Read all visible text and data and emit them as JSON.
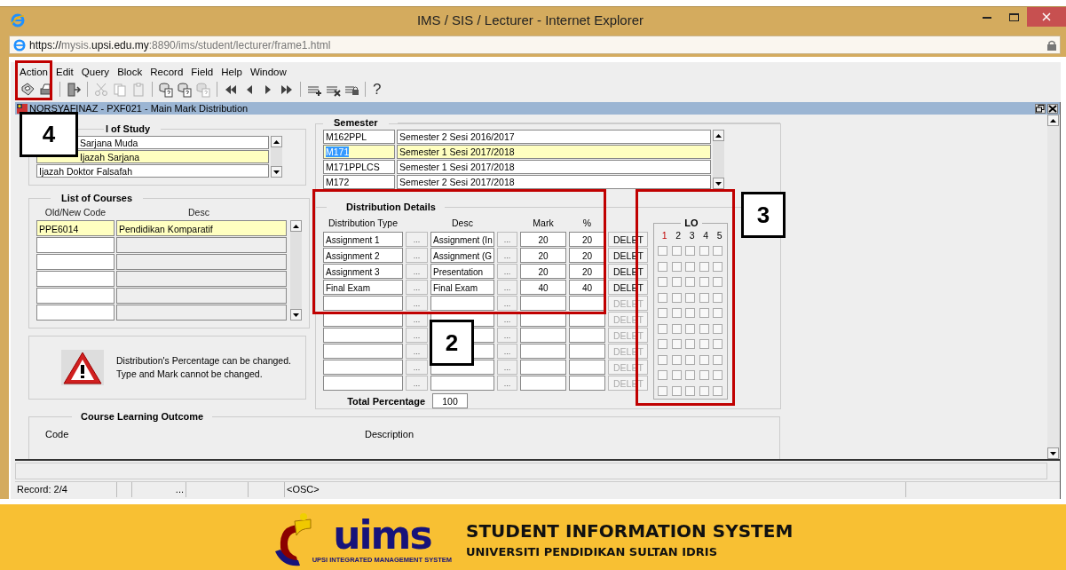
{
  "window": {
    "title": "IMS / SIS / Lecturer - Internet Explorer"
  },
  "address": {
    "scheme": "https://",
    "host_pre": "mysis.",
    "host": "upsi.edu.my",
    "rest": ":8890/ims/student/lecturer/frame1.html"
  },
  "menu": [
    "Action",
    "Edit",
    "Query",
    "Block",
    "Record",
    "Field",
    "Help",
    "Window"
  ],
  "toolbar": [
    {
      "kind": "save",
      "disabled": false
    },
    {
      "kind": "print",
      "disabled": false
    },
    {
      "kind": "sep"
    },
    {
      "kind": "exit",
      "disabled": false
    },
    {
      "kind": "sep"
    },
    {
      "kind": "cut",
      "disabled": true
    },
    {
      "kind": "copy",
      "disabled": true
    },
    {
      "kind": "paste",
      "disabled": true
    },
    {
      "kind": "sep"
    },
    {
      "kind": "query",
      "disabled": false
    },
    {
      "kind": "execute",
      "disabled": false
    },
    {
      "kind": "cancel",
      "disabled": true
    },
    {
      "kind": "sep"
    },
    {
      "kind": "first",
      "disabled": false
    },
    {
      "kind": "prev",
      "disabled": false
    },
    {
      "kind": "next",
      "disabled": false
    },
    {
      "kind": "last",
      "disabled": false
    },
    {
      "kind": "sep"
    },
    {
      "kind": "insert",
      "disabled": false
    },
    {
      "kind": "delete",
      "disabled": false
    },
    {
      "kind": "lock",
      "disabled": false
    },
    {
      "kind": "sep"
    },
    {
      "kind": "help",
      "text": "?"
    }
  ],
  "form": {
    "title": "NORSYAFINAZ - PXF021 - Main Mark Distribution"
  },
  "level_of_study": {
    "title": "l of Study",
    "items": [
      {
        "label": "Sarjana Muda",
        "selected": false
      },
      {
        "label": "Ijazah Sarjana",
        "selected": true
      },
      {
        "label": "Ijazah Doktor Falsafah",
        "selected": false
      }
    ]
  },
  "courses": {
    "title": "List of Courses",
    "columns": [
      "Old/New Code",
      "Desc"
    ],
    "rows": [
      {
        "code": "PPE6014",
        "desc": "Pendidikan Komparatif",
        "selected": true
      },
      {
        "selected": false
      },
      {
        "selected": false
      },
      {
        "selected": false
      },
      {
        "selected": false
      },
      {
        "selected": false
      }
    ]
  },
  "notice": {
    "lines": [
      "Distribution's Percentage can be changed.",
      "Type and Mark cannot be changed."
    ]
  },
  "semester": {
    "title": "Semester",
    "rows": [
      {
        "code": "M162PPL",
        "desc": "Semester 2 Sesi 2016/2017",
        "selected": false,
        "code_highlighted": false
      },
      {
        "code": "M171",
        "desc": "Semester 1 Sesi 2017/2018",
        "selected": true,
        "code_highlighted": true
      },
      {
        "code": "M171PPLCS",
        "desc": "Semester 1 Sesi 2017/2018",
        "selected": false,
        "code_highlighted": false
      },
      {
        "code": "M172",
        "desc": "Semester 2 Sesi 2017/2018",
        "selected": false,
        "code_highlighted": false
      }
    ]
  },
  "distribution": {
    "title": "Distribution Details",
    "columns": [
      "Distribution Type",
      "Desc",
      "Mark",
      "%"
    ],
    "rows": [
      {
        "type": "Assignment 1",
        "type_button": "...",
        "desc": "Assignment (In",
        "desc_button": "...",
        "mark": "20",
        "percent": "20",
        "delete": "DELET",
        "disabled": false
      },
      {
        "type": "Assignment 2",
        "type_button": "...",
        "desc": "Assignment (G",
        "desc_button": "...",
        "mark": "20",
        "percent": "20",
        "delete": "DELET",
        "disabled": false
      },
      {
        "type": "Assignment 3",
        "type_button": "...",
        "desc": "Presentation",
        "desc_button": "...",
        "mark": "20",
        "percent": "20",
        "delete": "DELET",
        "disabled": false
      },
      {
        "type": "Final Exam",
        "type_button": "...",
        "desc": "Final Exam",
        "desc_button": "...",
        "mark": "40",
        "percent": "40",
        "delete": "DELET",
        "disabled": false
      },
      {
        "type_button": "...",
        "desc_button": "...",
        "delete": "DELET",
        "disabled": true
      },
      {
        "type_button": "...",
        "desc_button": "...",
        "delete": "DELET",
        "disabled": true
      },
      {
        "type_button": "...",
        "desc_button": "...",
        "delete": "DELET",
        "disabled": true
      },
      {
        "type_button": "...",
        "desc_button": "...",
        "delete": "DELET",
        "disabled": true
      },
      {
        "type_button": "...",
        "desc_button": "...",
        "delete": "DELET",
        "disabled": true
      },
      {
        "type_button": "...",
        "desc_button": "...",
        "delete": "DELET",
        "disabled": true
      }
    ],
    "total_label": "Total Percentage",
    "total": "100"
  },
  "lo": {
    "title": "LO",
    "columns": [
      {
        "label": "1",
        "selected": true
      },
      {
        "label": "2",
        "selected": false
      },
      {
        "label": "3",
        "selected": false
      },
      {
        "label": "4",
        "selected": false
      },
      {
        "label": "5",
        "selected": false
      }
    ],
    "rows": [
      {
        "checked": [
          false,
          false,
          false,
          false,
          false
        ]
      },
      {
        "checked": [
          false,
          false,
          false,
          false,
          false
        ]
      },
      {
        "checked": [
          false,
          false,
          false,
          false,
          false
        ]
      },
      {
        "checked": [
          false,
          false,
          false,
          false,
          false
        ]
      },
      {
        "checked": [
          false,
          false,
          false,
          false,
          false
        ]
      },
      {
        "checked": [
          false,
          false,
          false,
          false,
          false
        ]
      },
      {
        "checked": [
          false,
          false,
          false,
          false,
          false
        ]
      },
      {
        "checked": [
          false,
          false,
          false,
          false,
          false
        ]
      },
      {
        "checked": [
          false,
          false,
          false,
          false,
          false
        ]
      },
      {
        "checked": [
          false,
          false,
          false,
          false,
          false
        ]
      }
    ]
  },
  "clo": {
    "title": "Course Learning Outcome",
    "columns": [
      "Code",
      "Description"
    ]
  },
  "status_bar": {
    "record": "Record: 2/4",
    "dots": "...",
    "mode": "<OSC>"
  },
  "footer": {
    "logo_text": "uims",
    "logo_tagline": "UPSI INTEGRATED MANAGEMENT SYSTEM",
    "title": "STUDENT INFORMATION SYSTEM",
    "subtitle": "UNIVERSITI PENDIDIKAN SULTAN IDRIS"
  },
  "callouts": [
    {
      "label": "4",
      "kind": "toolbar"
    },
    {
      "label": "2",
      "kind": "distribution"
    },
    {
      "label": "3",
      "kind": "lo"
    }
  ]
}
